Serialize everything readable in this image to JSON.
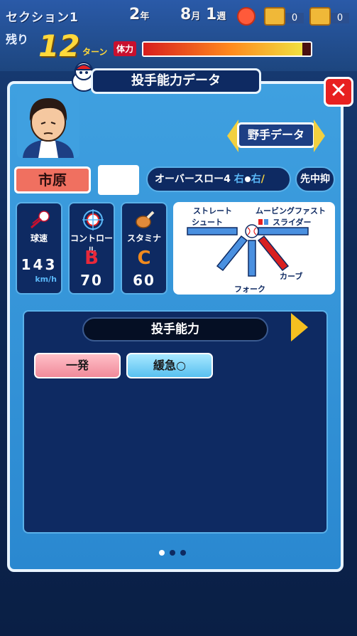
{
  "status": {
    "section": "セクション1",
    "year_num": "2",
    "year_unit": "年",
    "month_num": "8",
    "month_unit": "月",
    "week_num": "1",
    "week_unit": "週",
    "chest1_count": "0",
    "chest2_count": "0",
    "remaining_label": "残り",
    "turns_num": "12",
    "turns_unit": "ターン",
    "stamina_label": "体力",
    "stamina_level": 0.95
  },
  "panel": {
    "title": "投手能力データ",
    "fielder_button": "野手データ",
    "close_label": "✕"
  },
  "player": {
    "name": "市原",
    "form": "オーバースロー4",
    "hand_throw": "右",
    "hand_bat": "右",
    "role": "先中抑"
  },
  "stats": {
    "speed_label": "球速",
    "speed_value": "143",
    "speed_unit": "km/h",
    "control_label": "コントロール",
    "control_grade": "B",
    "control_value": "70",
    "stamina_label": "スタミナ",
    "stamina_grade": "C",
    "stamina_value": "60"
  },
  "pitches": {
    "straight": "ストレート",
    "moving_fast": "ムービングファスト",
    "shoot": "シュート",
    "slider": "スライダー",
    "curve": "カーブ",
    "fork": "フォーク"
  },
  "abilities": {
    "title": "投手能力",
    "items": [
      "一発",
      "緩急○"
    ]
  },
  "colors": {
    "grade_b": "#e8283a",
    "grade_c": "#f08a1e",
    "panel_bg": "#3fa0e0",
    "dark_navy": "#0e2a62"
  }
}
